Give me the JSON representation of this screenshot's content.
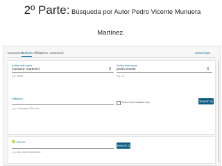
{
  "slide": {
    "title_big": "2º Parte:",
    "title_rest": " Búsqueda por Autor Pedro Vicente Munuera",
    "title_line2": "Martínez."
  },
  "tabs": [
    {
      "label": "Documents",
      "active": false
    },
    {
      "label": "Authors",
      "active": true
    },
    {
      "label": "Affiliations",
      "active": false
    },
    {
      "label": "Advanced",
      "active": false
    }
  ],
  "search_tips": "Search tips",
  "author_last_name": {
    "label": "Author last name",
    "value": "munuera- martínez|",
    "hint": "e.g. Smith"
  },
  "author_first_name": {
    "label": "Author first name",
    "value": "pedro vicente",
    "hint": "e.g. J.L."
  },
  "affiliation": {
    "label": "Affiliation",
    "value": "",
    "hint": "e.g. University of Toronto"
  },
  "exact_matches": {
    "label": "Show exact matches only",
    "checked": false
  },
  "search_button": "Search Q",
  "orcid": {
    "label": "ORCID",
    "hint": "e.g. 1111-2222-3333-444x"
  },
  "clear_symbol": "X",
  "orcid_badge": "iD",
  "colors": {
    "accent": "#007398",
    "button": "#0d5e85",
    "orcid": "#a6ce39"
  }
}
